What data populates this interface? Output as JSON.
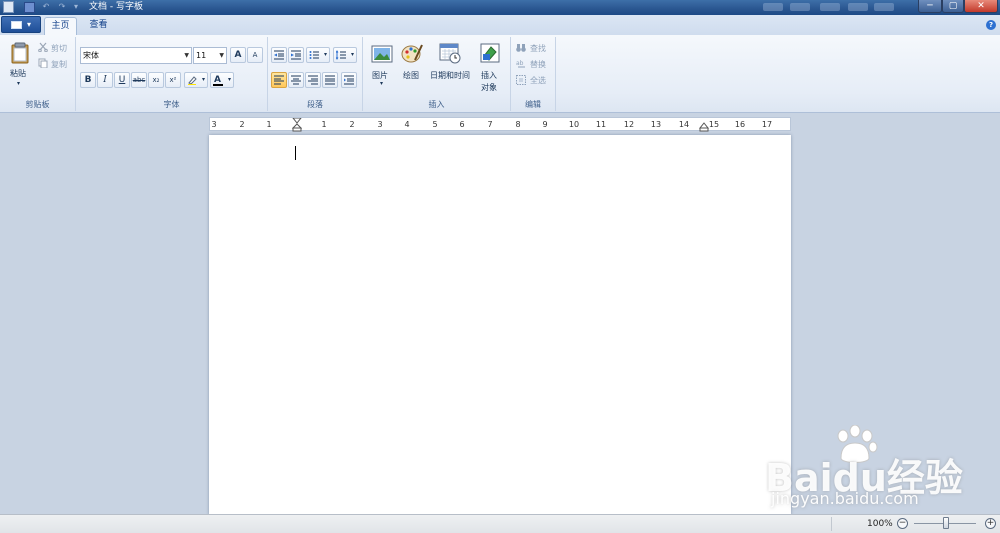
{
  "titlebar": {
    "title": "文档 - 写字板",
    "minimize": "─",
    "maximize": "▢",
    "close": "✕"
  },
  "quick_access": {
    "undo": "↶",
    "redo": "↷",
    "customize": "▾"
  },
  "tabs": [
    {
      "label": "主页"
    },
    {
      "label": "查看"
    }
  ],
  "help": "?",
  "clipboard": {
    "paste": "粘贴",
    "cut": "剪切",
    "copy": "复制",
    "group": "剪贴板"
  },
  "font": {
    "name": "宋体",
    "size": "11",
    "grow": "A",
    "shrink": "A",
    "bold": "B",
    "italic": "I",
    "underline": "U",
    "strike": "abc",
    "sub": "x₂",
    "sup": "x²",
    "group": "字体"
  },
  "paragraph": {
    "group": "段落"
  },
  "insert": {
    "picture": "图片",
    "paint": "绘图",
    "datetime": "日期和时间",
    "object_line1": "插入",
    "object_line2": "对象",
    "group": "插入"
  },
  "edit": {
    "find": "查找",
    "replace": "替换",
    "select_all": "全选",
    "group": "编辑"
  },
  "ruler": [
    "3",
    "2",
    "1",
    "1",
    "2",
    "3",
    "4",
    "5",
    "6",
    "7",
    "8",
    "9",
    "10",
    "11",
    "12",
    "13",
    "14",
    "15",
    "16",
    "17"
  ],
  "status": {
    "zoom": "100%",
    "zoom_out": "−",
    "zoom_in": "+"
  },
  "watermark": {
    "brand": "Baidu经验",
    "url": "jingyan.baidu.com"
  },
  "colors": {
    "accent": "#2d70d1",
    "ribbon": "#e6edf7",
    "workspace": "#c8d3e2"
  }
}
